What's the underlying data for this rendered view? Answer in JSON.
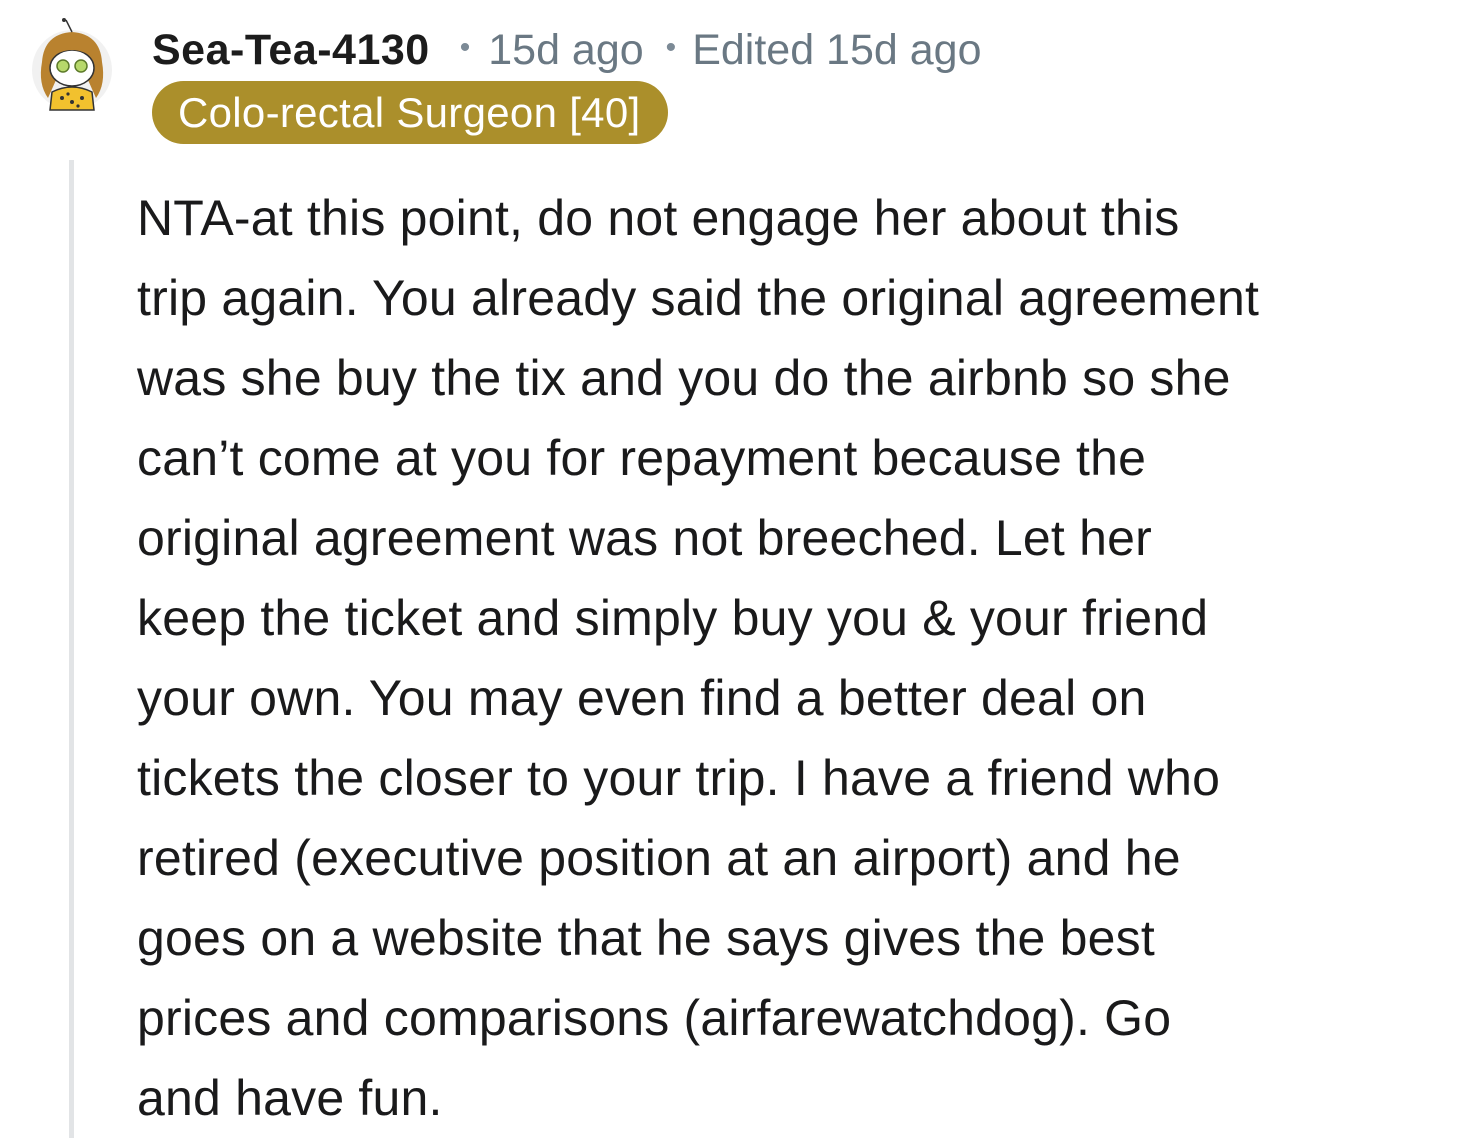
{
  "comment": {
    "author": "Sea-Tea-4130",
    "separator": "•",
    "age": "15d ago",
    "edited": "Edited 15d ago",
    "flair": "Colo-rectal Surgeon [40]",
    "flair_color": "#ab8f2b",
    "avatar_icon": "snoo-avatar-icon",
    "body_lines": [
      "NTA-at this point, do not engage her about this",
      "trip again. You already said the original agreement",
      "was she buy the tix and you do the airbnb so she",
      "can’t come at you for repayment because the",
      "original agreement was not breeched. Let her",
      "keep the ticket and simply buy you & your friend",
      "your own. You may even find a better deal on",
      "tickets the closer to your trip. I have a friend who",
      "retired (executive position at an airport) and he",
      "goes on a website that he says gives the best",
      "prices and comparisons (airfarewatchdog). Go",
      "and have fun."
    ]
  }
}
